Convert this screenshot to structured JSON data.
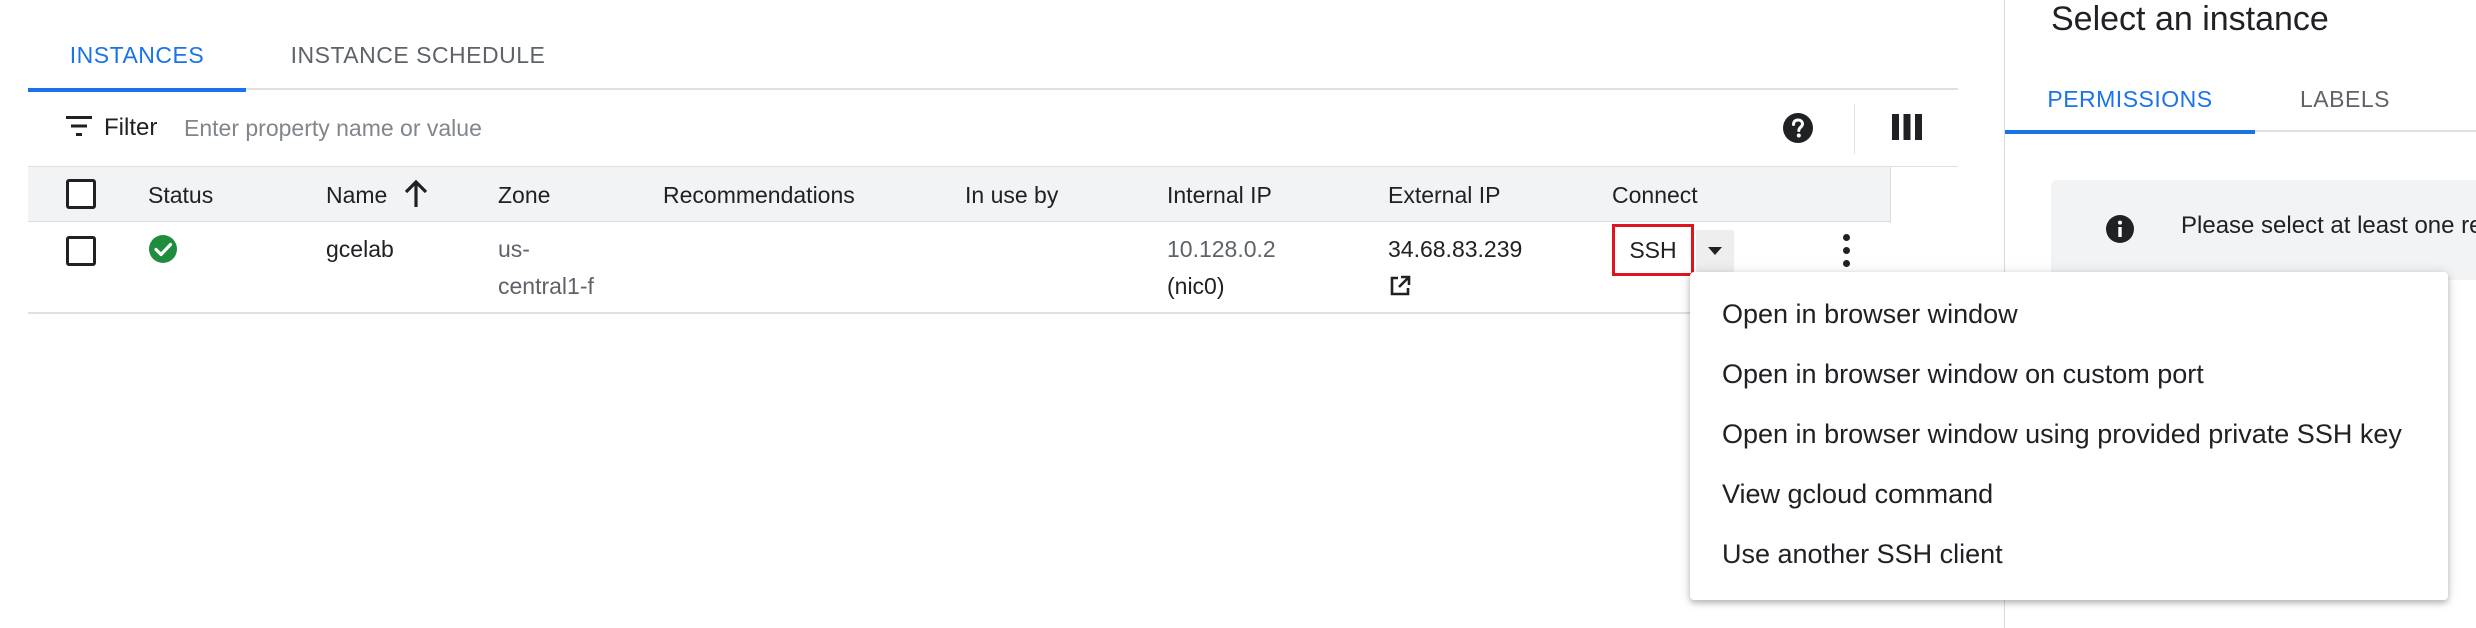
{
  "tabs": [
    {
      "label": "INSTANCES",
      "active": true
    },
    {
      "label": "INSTANCE SCHEDULE",
      "active": false
    }
  ],
  "filter": {
    "label": "Filter",
    "placeholder": "Enter property name or value"
  },
  "table": {
    "headers": {
      "status": "Status",
      "name": "Name",
      "zone": "Zone",
      "recommendations": "Recommendations",
      "in_use_by": "In use by",
      "internal_ip": "Internal IP",
      "external_ip": "External IP",
      "connect": "Connect"
    },
    "sort": {
      "column": "Name",
      "direction": "ascending"
    },
    "rows": [
      {
        "status": "running",
        "name": "gcelab",
        "zone_line1": "us-",
        "zone_line2": "central1-f",
        "recommendations": "",
        "in_use_by": "",
        "internal_ip": "10.128.0.2",
        "internal_nic": "(nic0)",
        "external_ip": "34.68.83.239",
        "connect_label": "SSH"
      }
    ]
  },
  "ssh_menu": {
    "items": [
      "Open in browser window",
      "Open in browser window on custom port",
      "Open in browser window using provided private SSH key",
      "View gcloud command",
      "Use another SSH client"
    ]
  },
  "right_panel": {
    "title": "Select an instance",
    "tabs": [
      {
        "label": "PERMISSIONS",
        "active": true
      },
      {
        "label": "LABELS",
        "active": false
      }
    ],
    "info_text": "Please select at least one re"
  },
  "colors": {
    "accent": "#1a73e8",
    "status_ok": "#1e8e3e",
    "highlight": "#e0141f"
  },
  "icons": {
    "filter": "filter-lines-icon",
    "help": "help-circle-icon",
    "columns": "column-display-icon",
    "sort": "arrow-up-icon",
    "status": "check-circle-icon",
    "external_link": "open-in-new-icon",
    "dropdown": "caret-down-icon",
    "more": "more-vertical-icon",
    "info": "info-icon"
  }
}
